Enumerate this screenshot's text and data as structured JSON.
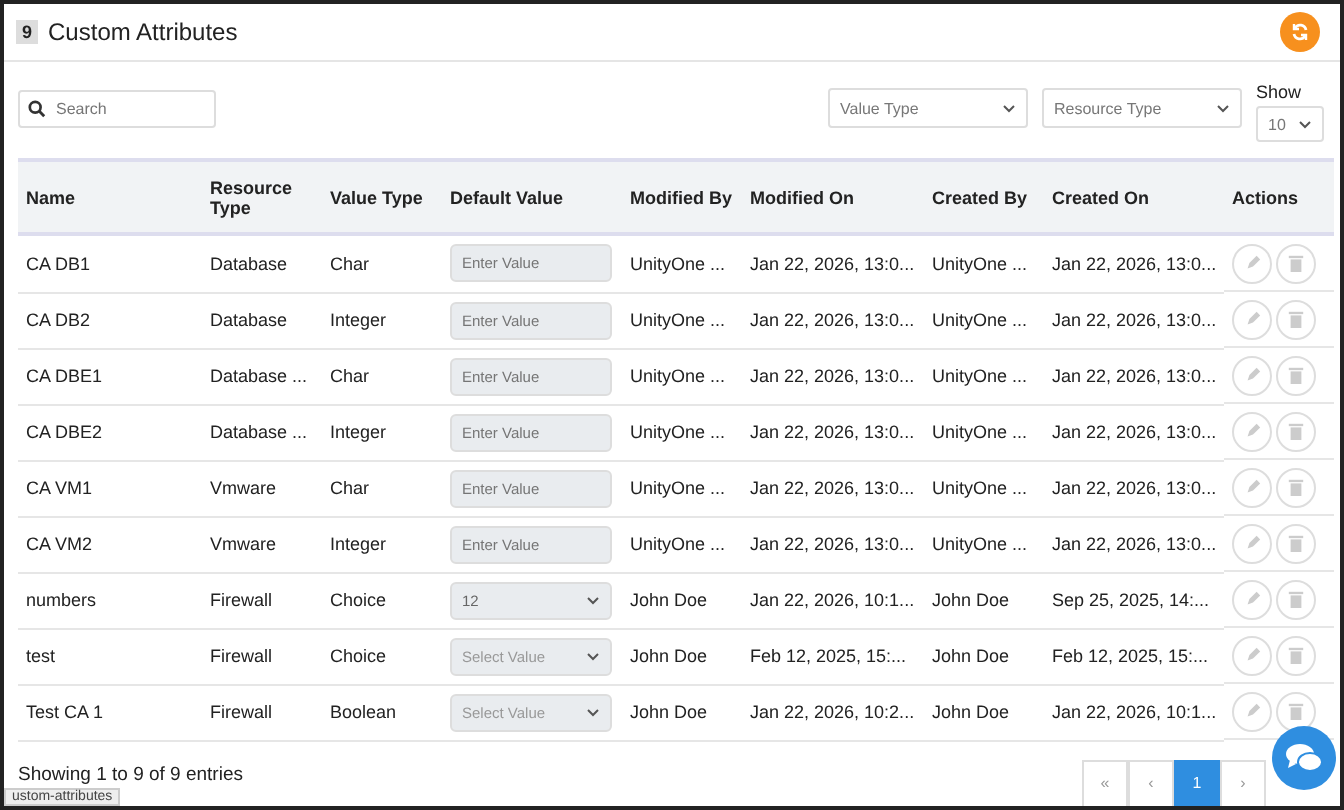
{
  "header": {
    "count": "9",
    "title": "Custom Attributes"
  },
  "search": {
    "placeholder": "Search"
  },
  "filters": [
    {
      "placeholder": "Value Type"
    },
    {
      "placeholder": "Resource Type"
    }
  ],
  "page_size": {
    "label": "Show",
    "value": "10"
  },
  "table": {
    "columns": [
      "Name",
      "Resource Type",
      "Value Type",
      "Default Value",
      "Modified By",
      "Modified On",
      "Created By",
      "Created On",
      "Actions"
    ],
    "rows": [
      {
        "name": "CA DB1",
        "resource_type": "Database",
        "value_type": "Char",
        "default": {
          "kind": "input",
          "placeholder": "Enter Value"
        },
        "modified_by": "UnityOne ...",
        "modified_on": "Jan 22, 2026, 13:0...",
        "created_by": "UnityOne ...",
        "created_on": "Jan 22, 2026, 13:0..."
      },
      {
        "name": "CA DB2",
        "resource_type": "Database",
        "value_type": "Integer",
        "default": {
          "kind": "input",
          "placeholder": "Enter Value"
        },
        "modified_by": "UnityOne ...",
        "modified_on": "Jan 22, 2026, 13:0...",
        "created_by": "UnityOne ...",
        "created_on": "Jan 22, 2026, 13:0..."
      },
      {
        "name": "CA DBE1",
        "resource_type": "Database ...",
        "value_type": "Char",
        "default": {
          "kind": "input",
          "placeholder": "Enter Value"
        },
        "modified_by": "UnityOne ...",
        "modified_on": "Jan 22, 2026, 13:0...",
        "created_by": "UnityOne ...",
        "created_on": "Jan 22, 2026, 13:0..."
      },
      {
        "name": "CA DBE2",
        "resource_type": "Database ...",
        "value_type": "Integer",
        "default": {
          "kind": "input",
          "placeholder": "Enter Value"
        },
        "modified_by": "UnityOne ...",
        "modified_on": "Jan 22, 2026, 13:0...",
        "created_by": "UnityOne ...",
        "created_on": "Jan 22, 2026, 13:0..."
      },
      {
        "name": "CA VM1",
        "resource_type": "Vmware",
        "value_type": "Char",
        "default": {
          "kind": "input",
          "placeholder": "Enter Value"
        },
        "modified_by": "UnityOne ...",
        "modified_on": "Jan 22, 2026, 13:0...",
        "created_by": "UnityOne ...",
        "created_on": "Jan 22, 2026, 13:0..."
      },
      {
        "name": "CA VM2",
        "resource_type": "Vmware",
        "value_type": "Integer",
        "default": {
          "kind": "input",
          "placeholder": "Enter Value"
        },
        "modified_by": "UnityOne ...",
        "modified_on": "Jan 22, 2026, 13:0...",
        "created_by": "UnityOne ...",
        "created_on": "Jan 22, 2026, 13:0..."
      },
      {
        "name": "numbers",
        "resource_type": "Firewall",
        "value_type": "Choice",
        "default": {
          "kind": "select",
          "value": "12"
        },
        "modified_by": "John Doe",
        "modified_on": "Jan 22, 2026, 10:1...",
        "created_by": "John Doe",
        "created_on": "Sep 25, 2025, 14:..."
      },
      {
        "name": "test",
        "resource_type": "Firewall",
        "value_type": "Choice",
        "default": {
          "kind": "select",
          "placeholder": "Select Value"
        },
        "modified_by": "John Doe",
        "modified_on": "Feb 12, 2025, 15:...",
        "created_by": "John Doe",
        "created_on": "Feb 12, 2025, 15:..."
      },
      {
        "name": "Test CA 1",
        "resource_type": "Firewall",
        "value_type": "Boolean",
        "default": {
          "kind": "select",
          "placeholder": "Select Value"
        },
        "modified_by": "John Doe",
        "modified_on": "Jan 22, 2026, 10:2...",
        "created_by": "John Doe",
        "created_on": "Jan 22, 2026, 10:1..."
      }
    ]
  },
  "summary": "Showing 1 to 9 of 9 entries",
  "pagination": [
    {
      "label": "«",
      "selected": false
    },
    {
      "label": "‹",
      "selected": false
    },
    {
      "label": "1",
      "selected": true
    },
    {
      "label": "›",
      "selected": false
    }
  ],
  "status_link": "ustom-attributes"
}
